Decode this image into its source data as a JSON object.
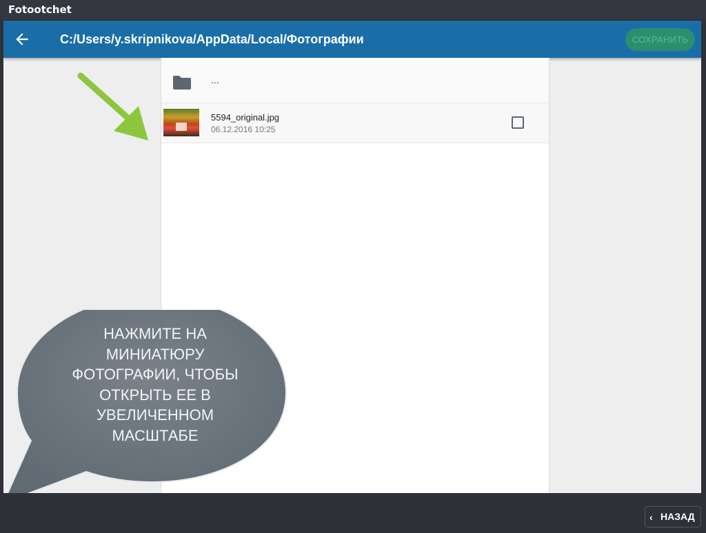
{
  "window": {
    "title": "Fotootchet"
  },
  "appbar": {
    "back_icon": "arrow-left-icon",
    "path": "C:/Users/y.skripnikova/AppData/Local/Фотографии",
    "save_label": "СОХРАНИТЬ",
    "colors": {
      "bar": "#1a6ea8",
      "save_button": "#2a8f6f"
    }
  },
  "files": {
    "parent": {
      "icon": "folder-icon",
      "label": "..."
    },
    "items": [
      {
        "name": "5594_original.jpg",
        "date": "06.12.2016 10:25",
        "checked": false
      }
    ]
  },
  "callout": {
    "text": "НАЖМИТЕ НА МИНИАТЮРУ ФОТОГРАФИИ, ЧТОБЫ ОТКРЫТЬ ЕЕ В УВЕЛИЧЕННОМ МАСШТАБЕ",
    "lines": [
      "НАЖМИТЕ НА",
      "МИНИАТЮРУ",
      "ФОТОГРАФИИ, ЧТОБЫ",
      "ОТКРЫТЬ ЕЕ В",
      "УВЕЛИЧЕННОМ",
      "МАСШТАБЕ"
    ],
    "pointer_color": "#8cc63f"
  },
  "footer": {
    "back_label": "НАЗАД",
    "back_icon": "chevron-left-icon"
  }
}
